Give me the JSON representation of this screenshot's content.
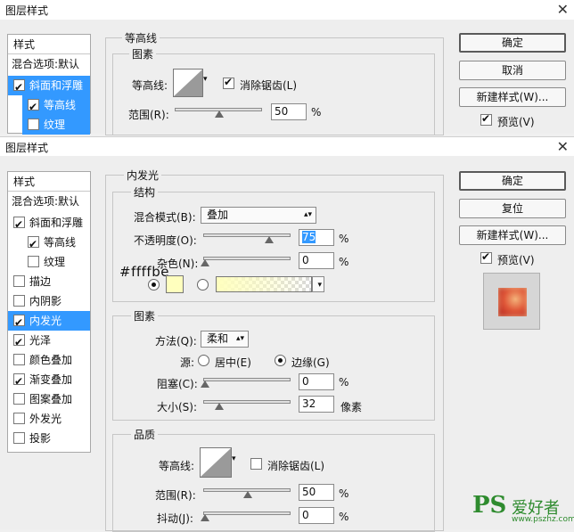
{
  "back_dialog": {
    "title": "图层样式",
    "left_list": {
      "header": "样式",
      "items": [
        {
          "label": "混合选项:默认",
          "checked": null,
          "selected": false
        },
        {
          "label": "斜面和浮雕",
          "checked": true,
          "selected": true
        },
        {
          "label": "等高线",
          "checked": true,
          "selected": true
        },
        {
          "label": "纹理",
          "checked": false,
          "selected": true
        }
      ]
    },
    "section_title": "等高线",
    "group_title": "图素",
    "contour_label": "等高线:",
    "antialias_label": "消除锯齿(L)",
    "range_label": "范围(R):",
    "range_value": "50",
    "percent": "%",
    "buttons": {
      "ok": "确定",
      "cancel": "取消",
      "new_style": "新建样式(W)..."
    },
    "preview_label": "预览(V)"
  },
  "front_dialog": {
    "title": "图层样式",
    "left_list": {
      "header": "样式",
      "blend_options": "混合选项:默认",
      "items": [
        {
          "label": "斜面和浮雕",
          "checked": true,
          "indent": false,
          "selected": false
        },
        {
          "label": "等高线",
          "checked": true,
          "indent": true,
          "selected": false
        },
        {
          "label": "纹理",
          "checked": false,
          "indent": true,
          "selected": false
        },
        {
          "label": "描边",
          "checked": false,
          "indent": false,
          "selected": false
        },
        {
          "label": "内阴影",
          "checked": false,
          "indent": false,
          "selected": false
        },
        {
          "label": "内发光",
          "checked": true,
          "indent": false,
          "selected": true
        },
        {
          "label": "光泽",
          "checked": true,
          "indent": false,
          "selected": false
        },
        {
          "label": "颜色叠加",
          "checked": false,
          "indent": false,
          "selected": false
        },
        {
          "label": "渐变叠加",
          "checked": true,
          "indent": false,
          "selected": false
        },
        {
          "label": "图案叠加",
          "checked": false,
          "indent": false,
          "selected": false
        },
        {
          "label": "外发光",
          "checked": false,
          "indent": false,
          "selected": false
        },
        {
          "label": "投影",
          "checked": false,
          "indent": false,
          "selected": false
        }
      ]
    },
    "section_title": "内发光",
    "structure": {
      "title": "结构",
      "blend_mode_label": "混合模式(B):",
      "blend_mode_value": "叠加",
      "opacity_label": "不透明度(O):",
      "opacity_value": "75",
      "opacity_level": 0.75,
      "noise_label": "杂色(N):",
      "noise_value": "0",
      "noise_level": 0,
      "color_hex_annotation": "#ffffbe",
      "glow_color": "#ffffbe",
      "percent": "%"
    },
    "elements": {
      "title": "图素",
      "method_label": "方法(Q):",
      "method_value": "柔和",
      "source_label": "源:",
      "source_center": "居中(E)",
      "source_edge": "边缘(G)",
      "choke_label": "阻塞(C):",
      "choke_value": "0",
      "choke_level": 0,
      "size_label": "大小(S):",
      "size_value": "32",
      "size_unit": "像素",
      "percent": "%"
    },
    "quality": {
      "title": "品质",
      "contour_label": "等高线:",
      "antialias_label": "消除锯齿(L)",
      "range_label": "范围(R):",
      "range_value": "50",
      "range_level": 0.5,
      "jitter_label": "抖动(J):",
      "jitter_value": "0",
      "jitter_level": 0,
      "percent": "%"
    },
    "buttons": {
      "ok": "确定",
      "reset": "复位",
      "new_style": "新建样式(W)..."
    },
    "preview_label": "预览(V)"
  },
  "watermark": {
    "brand": "PS",
    "text": "爱好者",
    "url": "www.pszhz.com"
  },
  "colors": {
    "selection_blue": "#3399ff",
    "panel_bg": "#eeeeee",
    "glow_yellow": "#ffffbe"
  }
}
